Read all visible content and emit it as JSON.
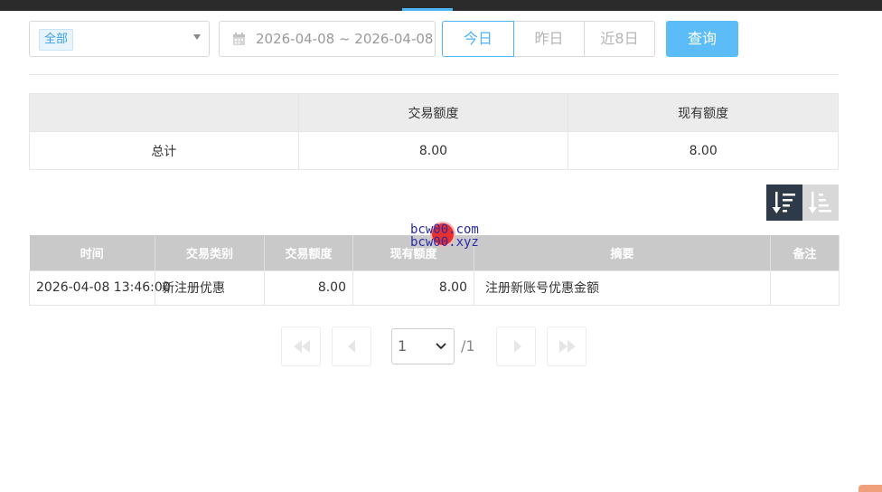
{
  "filters": {
    "category_tag": "全部",
    "date_range": "2026-04-08 ~ 2026-04-08",
    "quick_ranges": [
      "今日",
      "昨日",
      "近8日"
    ],
    "query_label": "查询"
  },
  "summary": {
    "headers": [
      "",
      "交易额度",
      "现有额度"
    ],
    "row": [
      "总计",
      "8.00",
      "8.00"
    ]
  },
  "detail": {
    "headers": [
      "时间",
      "交易类别",
      "交易额度",
      "现有额度",
      "摘要",
      "备注"
    ],
    "rows": [
      [
        "2026-04-08 13:46:00",
        "新注册优惠",
        "8.00",
        "8.00",
        "注册新账号优惠金额",
        ""
      ]
    ]
  },
  "watermark": [
    "bcw00.com",
    "bcw00.xyz"
  ],
  "pagination": {
    "current_page": "1",
    "total_label": "/1"
  },
  "colors": {
    "accent": "#4db3f5",
    "query_button": "#5bbcf7",
    "table_header": "#c9c9c9",
    "sort_active": "#2f3a48"
  }
}
